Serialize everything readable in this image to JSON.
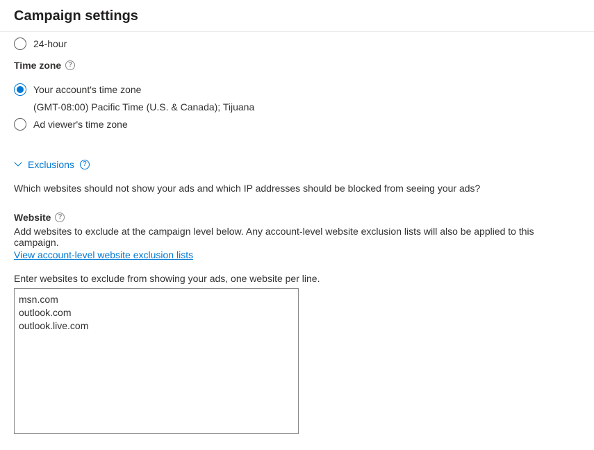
{
  "header": {
    "title": "Campaign settings"
  },
  "timeFormat": {
    "option24h": "24-hour"
  },
  "timeZone": {
    "label": "Time zone",
    "optionAccount": "Your account's time zone",
    "accountDetail": "(GMT-08:00) Pacific Time (U.S. & Canada); Tijuana",
    "optionAdViewer": "Ad viewer's time zone"
  },
  "exclusions": {
    "header": "Exclusions",
    "intro": "Which websites should not show your ads and which IP addresses should be blocked from seeing your ads?",
    "websiteLabel": "Website",
    "websiteDesc": "Add websites to exclude at the campaign level below. Any account-level website exclusion lists will also be applied to this campaign.",
    "viewAccountLink": "View account-level website exclusion lists",
    "enterLabel": "Enter websites to exclude from showing your ads, one website per line.",
    "textareaValue": "msn.com\noutlook.com\noutlook.live.com"
  }
}
